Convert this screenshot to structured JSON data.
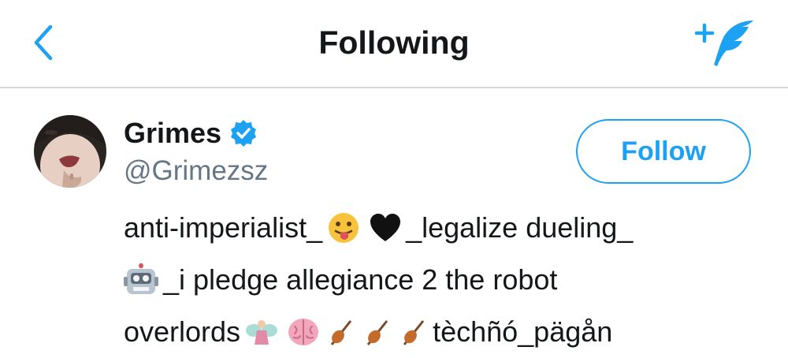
{
  "header": {
    "title": "Following",
    "back_icon": "chevron-left-icon",
    "compose_icon": "compose-tweet-icon"
  },
  "user": {
    "name": "Grimes",
    "handle": "@Grimezsz",
    "verified": true,
    "follow_label": "Follow"
  },
  "bio": {
    "line1_a": "anti-imperialist_",
    "line1_b": "_legalize dueling_",
    "line2": "_i pledge allegiance 2 the robot",
    "line3_a": "overlords",
    "line3_b": "tèchñó_pägån"
  },
  "colors": {
    "accent": "#1da1f2",
    "text": "#14171a",
    "secondary": "#657786",
    "divider": "#d6d9dc"
  }
}
